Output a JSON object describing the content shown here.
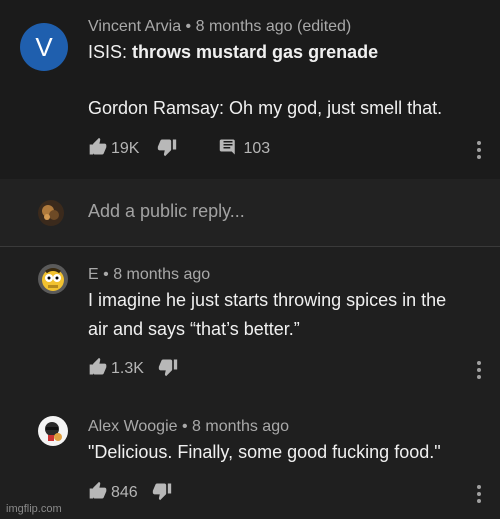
{
  "top_comment": {
    "author": "Vincent Arvia",
    "time": "8 months ago (edited)",
    "avatar_letter": "V",
    "line1_prefix": "ISIS:",
    "line1_bold": "throws mustard gas grenade",
    "line2": "Gordon Ramsay: Oh my god, just smell that.",
    "likes": "19K",
    "replies": "103"
  },
  "reply_box": {
    "placeholder": "Add a public reply..."
  },
  "replies": [
    {
      "author": "E",
      "time": "8 months ago",
      "line1": "I imagine he just starts throwing spices in the",
      "line2": "air and says “that’s better.”",
      "likes": "1.3K"
    },
    {
      "author": "Alex Woogie",
      "time": "8 months ago",
      "line1": "\"Delicious. Finally, some good fucking food.\"",
      "likes": "846"
    }
  ],
  "separator": "•",
  "watermark": "imgflip.com",
  "colors": {
    "background": "#1f1f1f",
    "avatar_blue": "#1f5fae",
    "text": "#f0f0f0",
    "muted": "#a9a9a9"
  },
  "icons": [
    "thumbs-up-icon",
    "thumbs-down-icon",
    "comment-icon",
    "more-vert-icon"
  ]
}
